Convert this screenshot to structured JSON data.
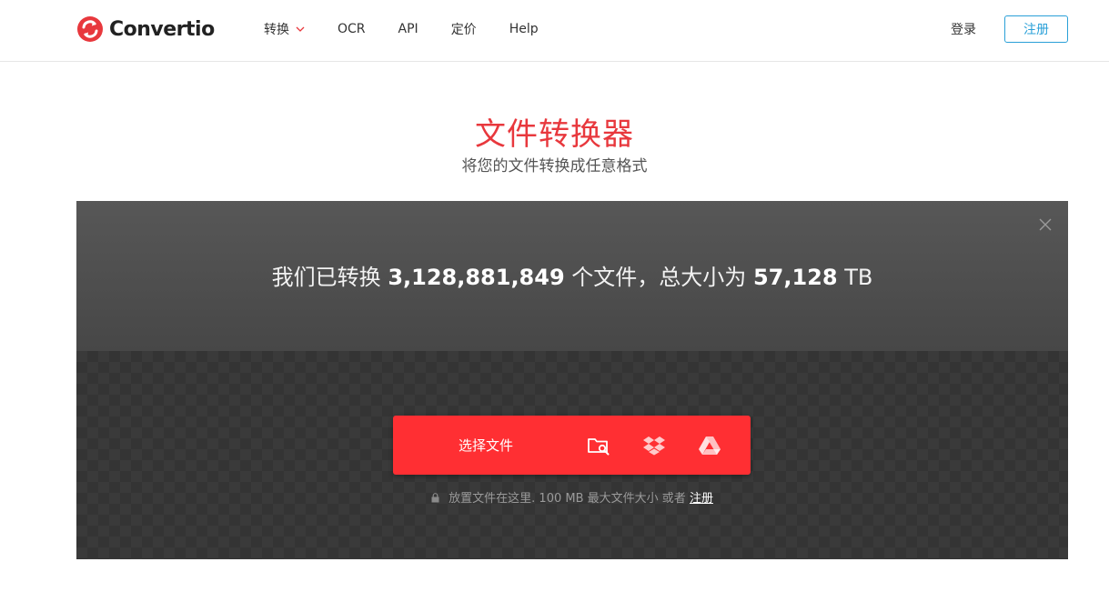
{
  "brand": {
    "name": "Convertio",
    "accent_color": "#e8383d"
  },
  "nav": {
    "items": [
      {
        "label": "转换",
        "has_dropdown": true
      },
      {
        "label": "OCR"
      },
      {
        "label": "API"
      },
      {
        "label": "定价"
      },
      {
        "label": "Help"
      }
    ],
    "login_label": "登录",
    "signup_label": "注册"
  },
  "hero": {
    "title": "文件转换器",
    "subtitle": "将您的文件转换成任意格式"
  },
  "stats": {
    "prefix": "我们已转换",
    "files_count": "3,128,881,849",
    "middle": "个文件，总大小为",
    "total_size": "57,128",
    "unit": "TB"
  },
  "upload": {
    "choose_label": "选择文件",
    "sources": [
      {
        "icon": "folder-search-icon"
      },
      {
        "icon": "dropbox-icon"
      },
      {
        "icon": "google-drive-icon"
      }
    ],
    "hint_text": "放置文件在这里. 100 MB 最大文件大小 或者",
    "hint_link": "注册",
    "button_color": "#ff2f33"
  }
}
